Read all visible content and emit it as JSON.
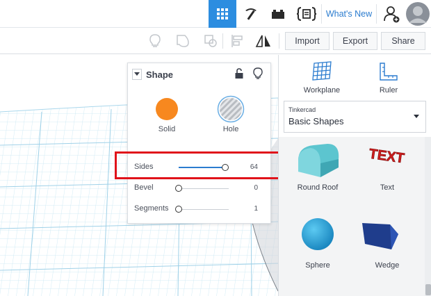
{
  "topbar": {
    "whats_new": "What's New",
    "icons": [
      "grid-icon",
      "pickaxe-icon",
      "brick-icon",
      "code-blocks-icon",
      "add-user-icon",
      "avatar"
    ]
  },
  "toolbar": {
    "import_label": "Import",
    "export_label": "Export",
    "share_label": "Share",
    "icons": [
      "lightbulb-icon",
      "group-icon",
      "ungroup-icon",
      "align-icon",
      "mirror-icon"
    ]
  },
  "inspector": {
    "title": "Shape",
    "solid_label": "Solid",
    "hole_label": "Hole",
    "solid_color": "#f7881f",
    "params": [
      {
        "label": "Sides",
        "value": "64",
        "fraction": 0.93
      },
      {
        "label": "Bevel",
        "value": "0",
        "fraction": 0.0
      },
      {
        "label": "Segments",
        "value": "1",
        "fraction": 0.0
      }
    ]
  },
  "right_panel": {
    "workplane_label": "Workplane",
    "ruler_label": "Ruler",
    "library_category": "Tinkercad",
    "library_name": "Basic Shapes",
    "shapes": [
      {
        "name": "Round Roof",
        "color": "#5cc5cf"
      },
      {
        "name": "Text",
        "color": "#d21e1e"
      },
      {
        "name": "Sphere",
        "color": "#1e9ed8"
      },
      {
        "name": "Wedge",
        "color": "#1f3d8c"
      }
    ],
    "text_shape_glyph": "TEXT"
  },
  "colors": {
    "accent": "#2b7ccf",
    "active_tab": "#2c8de0",
    "grid": "#bfe3f2",
    "highlight": "#e0121a"
  }
}
